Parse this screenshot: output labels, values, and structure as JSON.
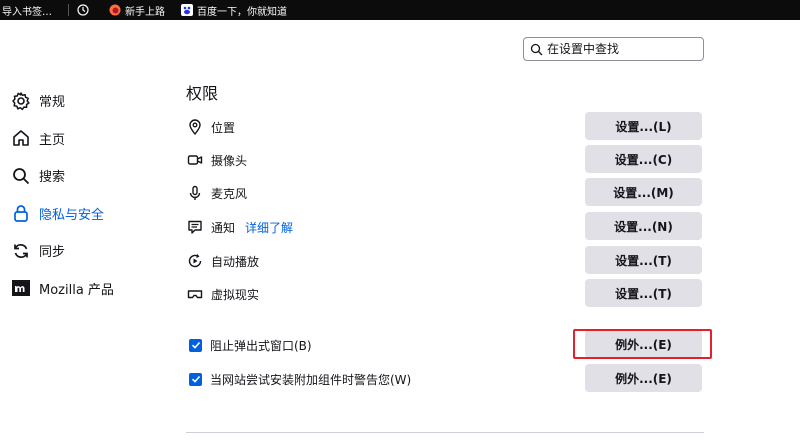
{
  "bookmarks": [
    {
      "label": "导入书签…",
      "icon": "import-icon"
    },
    {
      "label": "",
      "icon": "history-clock-icon"
    },
    {
      "label": "新手上路",
      "icon": "firefox-icon"
    },
    {
      "label": "百度一下，你就知道",
      "icon": "baidu-icon"
    }
  ],
  "search": {
    "placeholder": "在设置中查找"
  },
  "sidebar": {
    "items": [
      {
        "label": "常规",
        "icon": "gear-icon"
      },
      {
        "label": "主页",
        "icon": "home-icon"
      },
      {
        "label": "搜索",
        "icon": "search-icon"
      },
      {
        "label": "隐私与安全",
        "icon": "lock-icon",
        "active": true
      },
      {
        "label": "同步",
        "icon": "sync-icon"
      },
      {
        "label": "Mozilla 产品",
        "icon": "mozilla-icon"
      }
    ]
  },
  "main": {
    "title": "权限",
    "permissions": [
      {
        "label": "位置",
        "icon": "location-icon",
        "button": "设置...(L)"
      },
      {
        "label": "摄像头",
        "icon": "camera-icon",
        "button": "设置...(C)"
      },
      {
        "label": "麦克风",
        "icon": "microphone-icon",
        "button": "设置...(M)"
      },
      {
        "label": "通知",
        "icon": "notification-icon",
        "button": "设置...(N)",
        "link": "详细了解"
      },
      {
        "label": "自动播放",
        "icon": "autoplay-icon",
        "button": "设置...(T)"
      },
      {
        "label": "虚拟现实",
        "icon": "vr-icon",
        "button": "设置...(T)"
      }
    ],
    "checkboxes": [
      {
        "label": "阻止弹出式窗口(B)",
        "checked": true,
        "button": "例外...(E)"
      },
      {
        "label": "当网站尝试安装附加组件时警告您(W)",
        "checked": true,
        "button": "例外...(E)"
      }
    ]
  },
  "colors": {
    "accent": "#0061e0",
    "highlight": "#e5202c",
    "button_bg": "#e0e0e6"
  }
}
